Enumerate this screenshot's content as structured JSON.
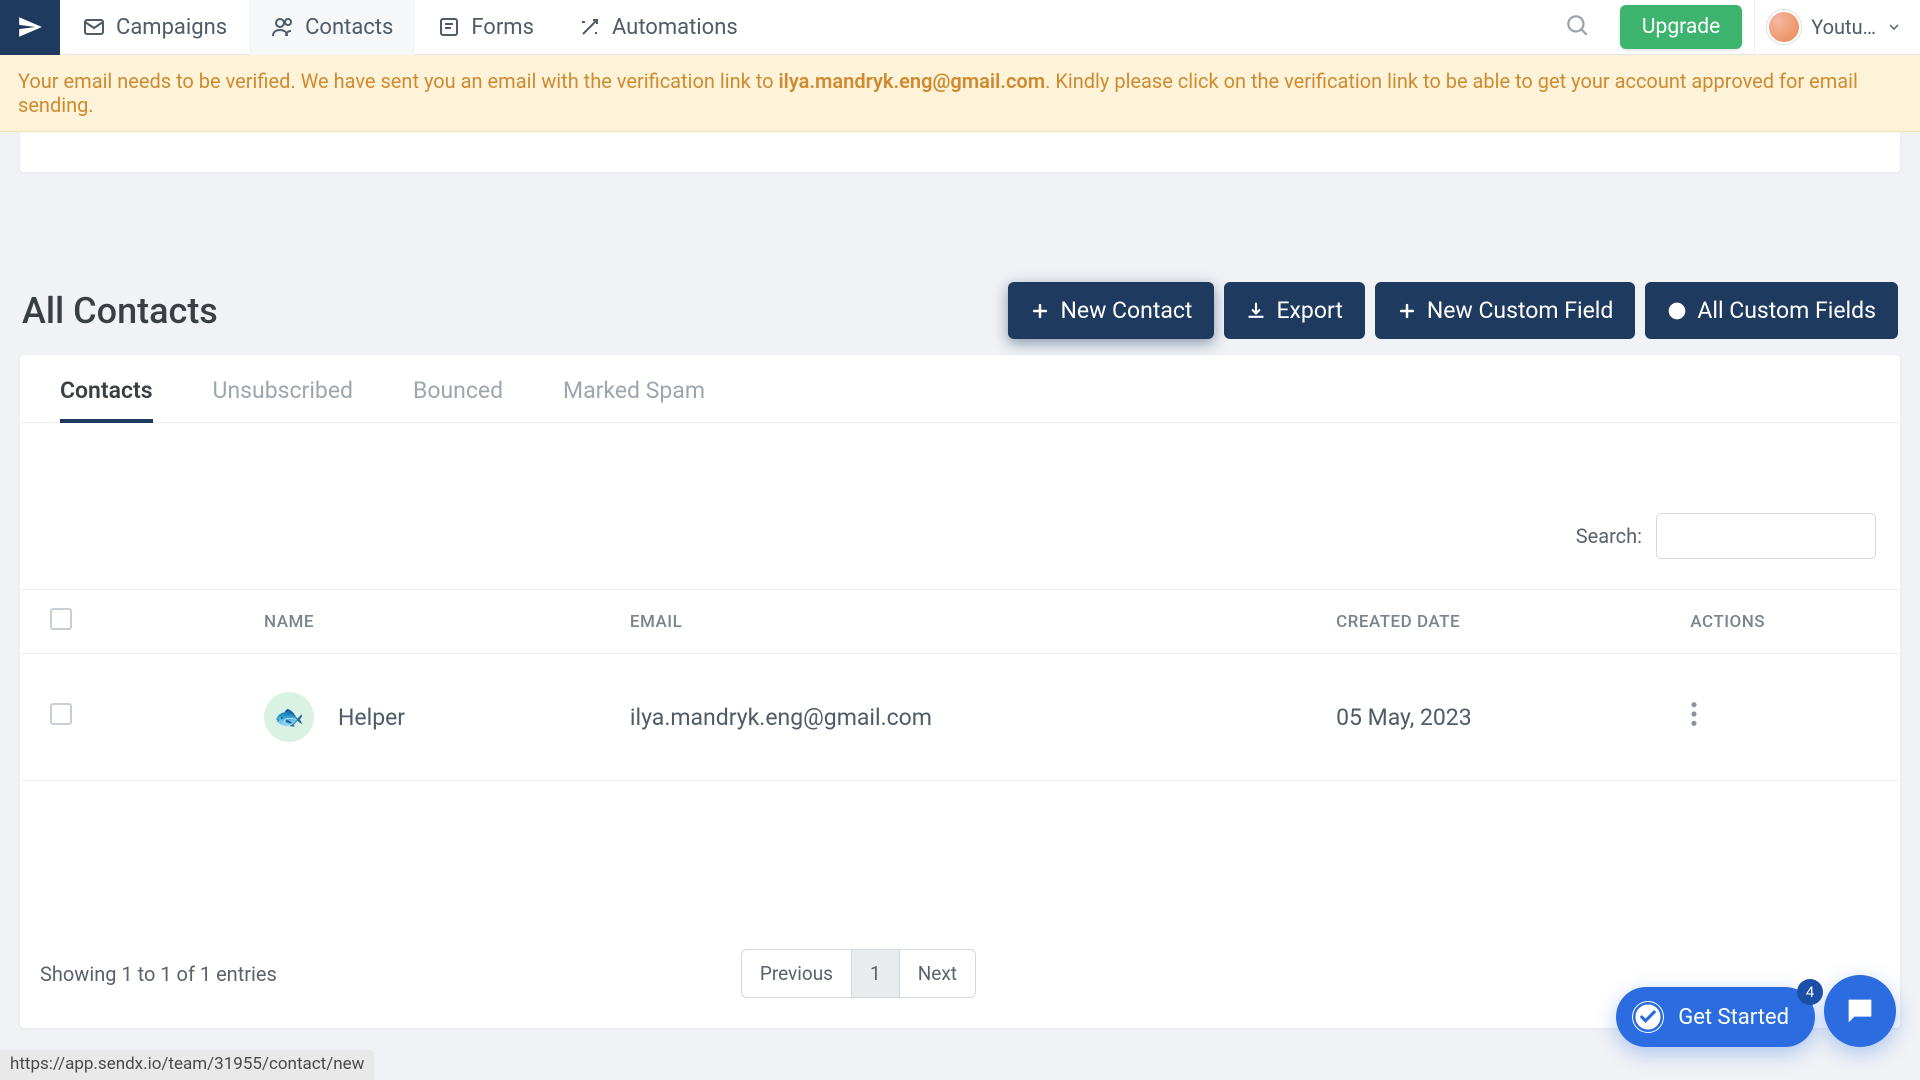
{
  "nav": {
    "items": [
      {
        "label": "Campaigns"
      },
      {
        "label": "Contacts"
      },
      {
        "label": "Forms"
      },
      {
        "label": "Automations"
      }
    ],
    "upgrade": "Upgrade",
    "user_label": "Youtu…"
  },
  "notice": {
    "prefix": "Your email needs to be verified. We have sent you an email with the verification link to ",
    "email": "ilya.mandryk.eng@gmail.com",
    "suffix": ". Kindly please click on the verification link to be able to get your account approved for email sending."
  },
  "page": {
    "title": "All Contacts"
  },
  "actions": {
    "new_contact": "New Contact",
    "export": "Export",
    "new_custom_field": "New Custom Field",
    "all_custom_fields": "All Custom Fields"
  },
  "tabs": {
    "contacts": "Contacts",
    "unsubscribed": "Unsubscribed",
    "bounced": "Bounced",
    "marked_spam": "Marked Spam"
  },
  "search": {
    "label": "Search:",
    "value": ""
  },
  "table": {
    "headers": {
      "name": "NAME",
      "email": "EMAIL",
      "created_date": "CREATED DATE",
      "actions": "ACTIONS"
    },
    "rows": [
      {
        "name": "Helper",
        "email": "ilya.mandryk.eng@gmail.com",
        "created_date": "05 May, 2023"
      }
    ]
  },
  "footer": {
    "showing": "Showing 1 to 1 of 1 entries",
    "prev": "Previous",
    "page": "1",
    "next": "Next"
  },
  "overlay": {
    "get_started": "Get Started",
    "badge": "4"
  },
  "status_url": "https://app.sendx.io/team/31955/contact/new"
}
